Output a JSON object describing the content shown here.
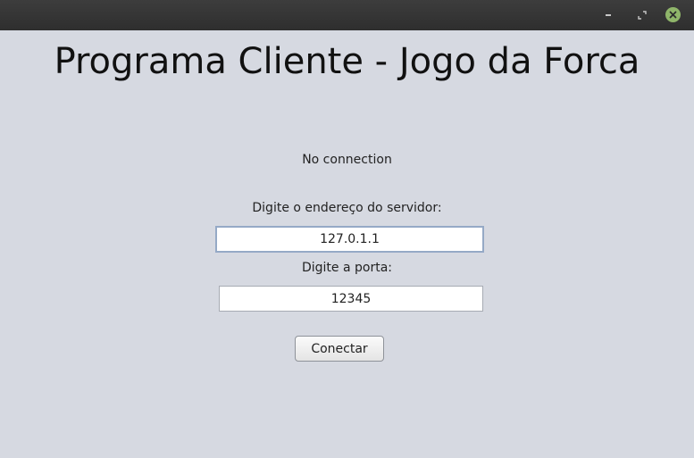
{
  "window": {
    "controls": {
      "minimize_icon": "minimize-icon",
      "maximize_icon": "maximize-icon",
      "close_icon": "close-icon",
      "close_color": "#8fb56a"
    }
  },
  "main": {
    "title": "Programa Cliente - Jogo da Forca",
    "status": "No connection",
    "address_label": "Digite o endereço do servidor:",
    "address_value": "127.0.1.1",
    "port_label": "Digite a porta:",
    "port_value": "12345",
    "connect_button": "Conectar"
  },
  "colors": {
    "background": "#d6d9e1",
    "titlebar": "#2e2e2e",
    "focus_border": "#95a9c6"
  }
}
